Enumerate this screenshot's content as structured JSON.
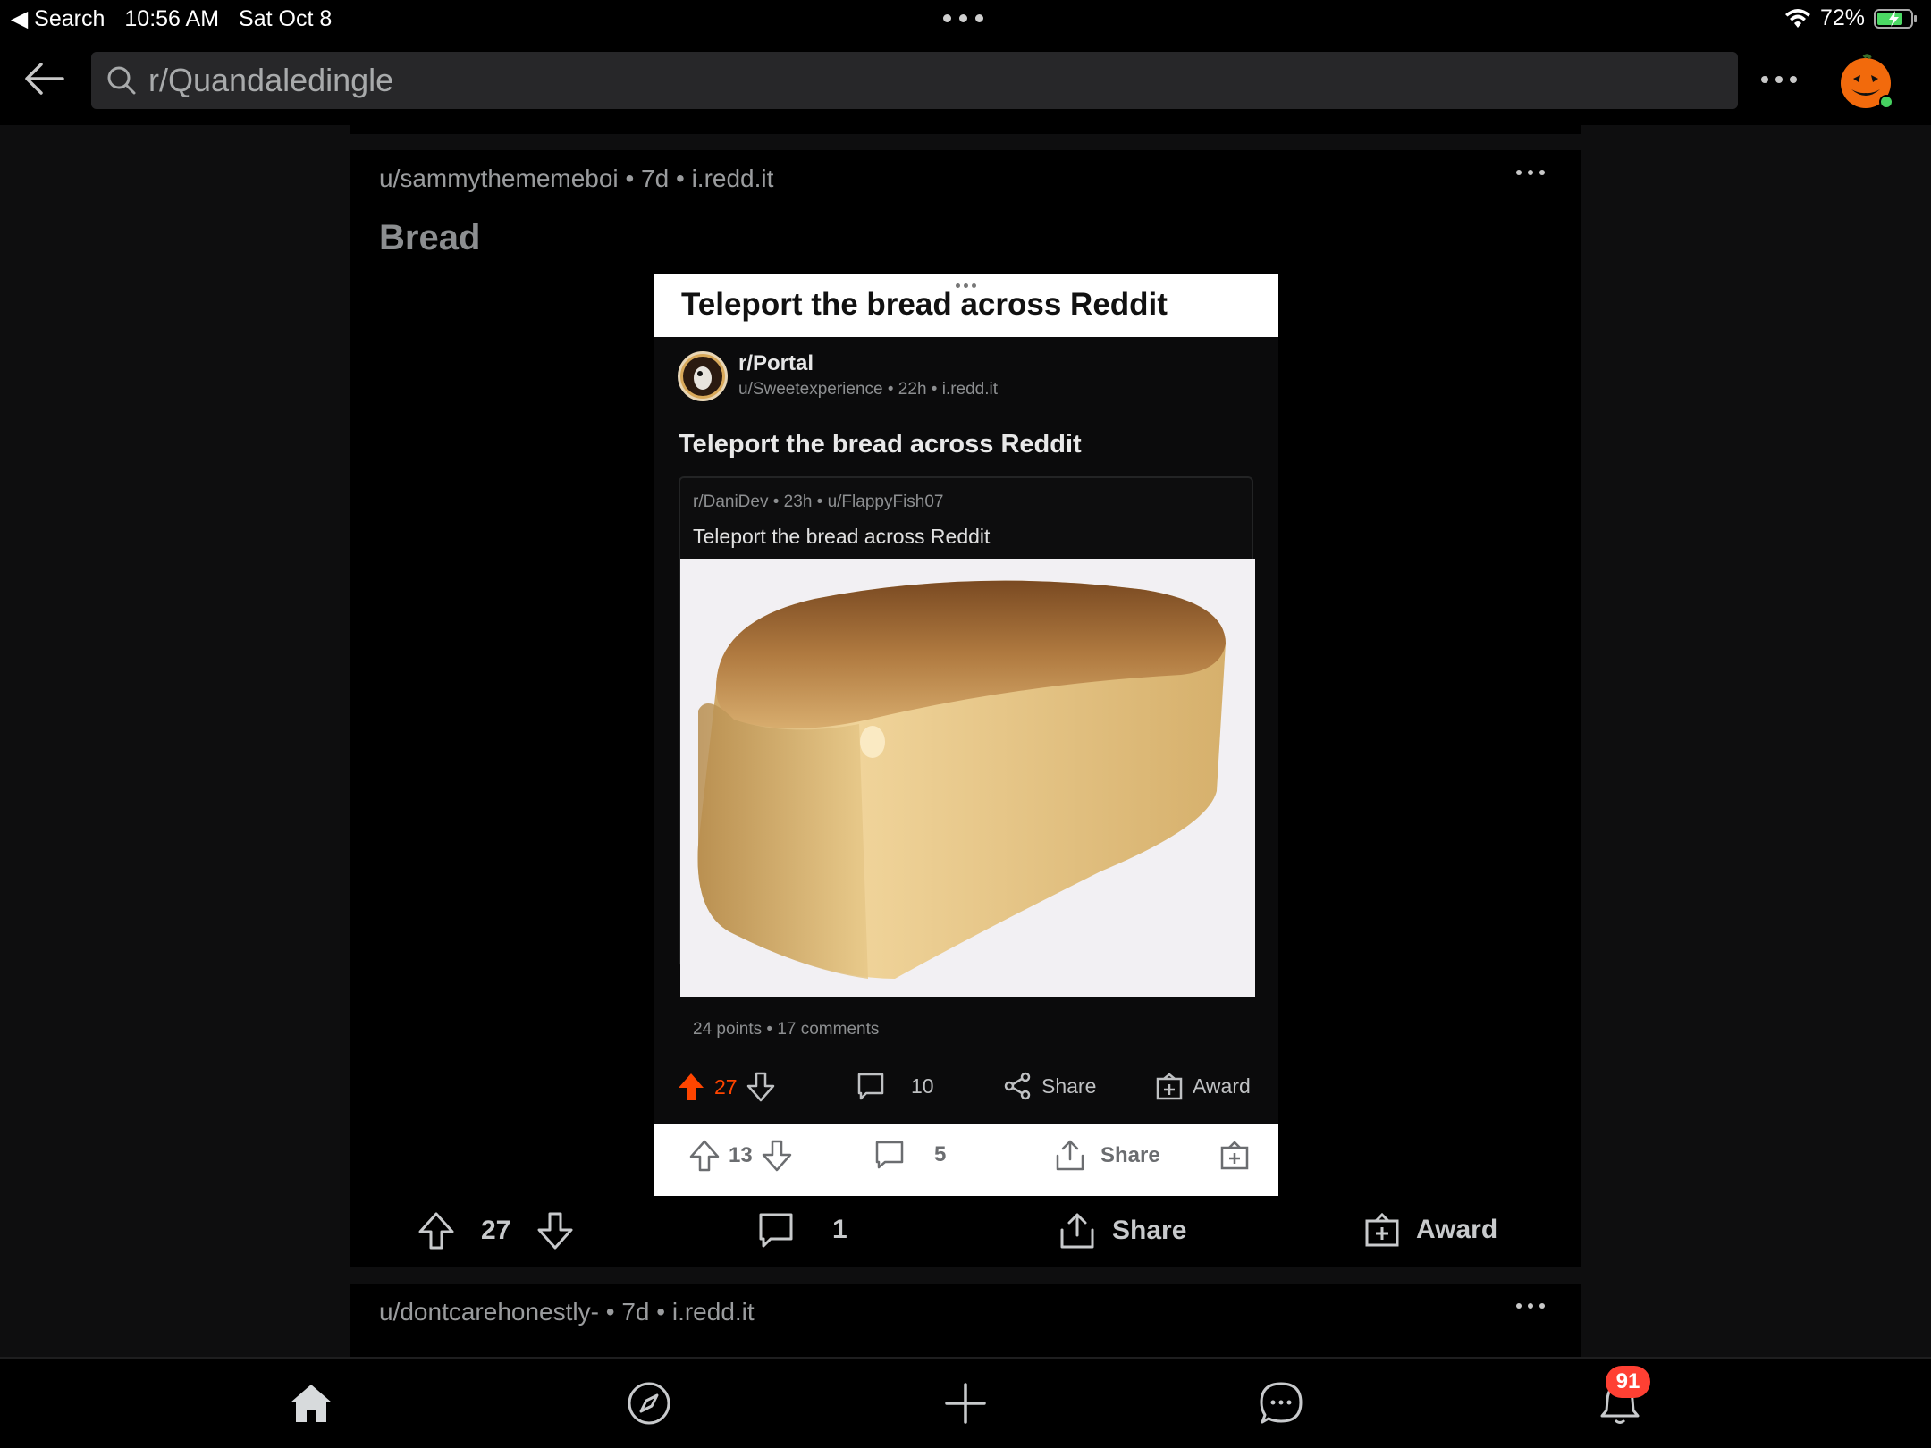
{
  "status_bar": {
    "back_app": "◀ Search",
    "time": "10:56 AM",
    "date": "Sat Oct 8",
    "battery": "72%"
  },
  "search": {
    "value": "r/Quandaledingle"
  },
  "post": {
    "author": "u/sammythememeboi",
    "age": "7d",
    "domain": "i.redd.it",
    "title": "Bread",
    "votes": "27",
    "comments": "1",
    "share_label": "Share",
    "award_label": "Award"
  },
  "embedded": {
    "header_title": "Teleport the bread across Reddit",
    "subreddit": "r/Portal",
    "submeta": "u/Sweetexperience • 22h • i.redd.it",
    "title": "Teleport the bread across Reddit",
    "crosspost": {
      "meta": "r/DaniDev • 23h • u/FlappyFish07",
      "title": "Teleport the bread across Reddit",
      "stats": "24 points • 17 comments"
    },
    "actions": {
      "votes": "27",
      "comments": "10",
      "share": "Share",
      "award": "Award"
    },
    "bottom": {
      "votes": "13",
      "comments": "5",
      "share": "Share"
    }
  },
  "next_post": {
    "author": "u/dontcarehonestly-",
    "age": "7d",
    "domain": "i.redd.it"
  },
  "tabbar": {
    "notification_count": "91"
  },
  "colors": {
    "upvote": "#ff4500",
    "badge": "#ff4033"
  }
}
